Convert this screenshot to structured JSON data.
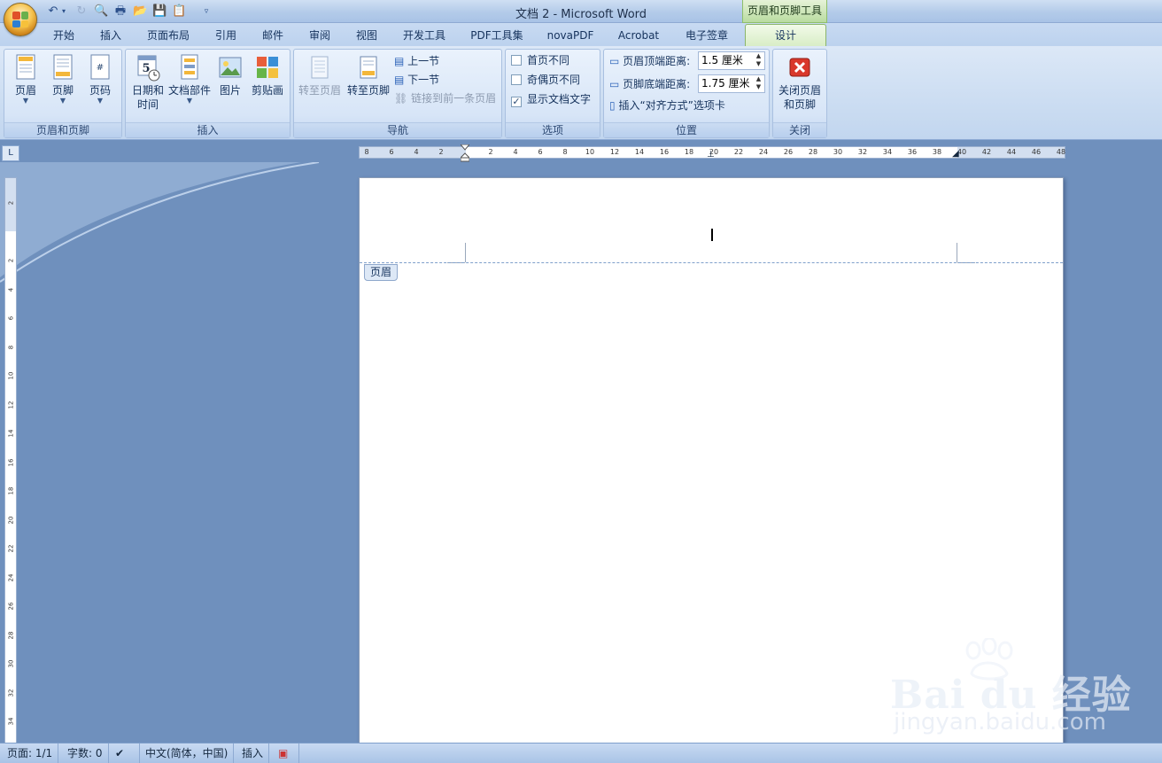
{
  "window": {
    "title": "文档 2 - Microsoft Word",
    "contextual_title": "页眉和页脚工具"
  },
  "qat": [
    "undo-icon",
    "redo-icon",
    "print-preview-icon",
    "print-icon",
    "open-icon",
    "save-icon",
    "paste-icon",
    "customize-icon"
  ],
  "tabs": [
    {
      "label": "开始"
    },
    {
      "label": "插入"
    },
    {
      "label": "页面布局"
    },
    {
      "label": "引用"
    },
    {
      "label": "邮件"
    },
    {
      "label": "审阅"
    },
    {
      "label": "视图"
    },
    {
      "label": "开发工具"
    },
    {
      "label": "PDF工具集"
    },
    {
      "label": "novaPDF"
    },
    {
      "label": "Acrobat"
    },
    {
      "label": "电子签章"
    }
  ],
  "active_tab": "设计",
  "ribbon": {
    "hf": {
      "label": "页眉和页脚",
      "header": "页眉",
      "footer": "页脚",
      "pagenum": "页码"
    },
    "insert": {
      "label": "插入",
      "datetime_1": "日期和",
      "datetime_2": "时间",
      "parts": "文档部件",
      "picture": "图片",
      "clipart": "剪贴画"
    },
    "nav": {
      "label": "导航",
      "goto_header": "转至页眉",
      "goto_footer": "转至页脚",
      "prev": "上一节",
      "next": "下一节",
      "link": "链接到前一条页眉"
    },
    "options": {
      "label": "选项",
      "first_diff": "首页不同",
      "odd_even": "奇偶页不同",
      "show_text": "显示文档文字",
      "first_checked": false,
      "odd_checked": false,
      "show_checked": true
    },
    "position": {
      "label": "位置",
      "header_top": "页眉顶端距离:",
      "header_top_value": "1.5 厘米",
      "footer_bottom": "页脚底端距离:",
      "footer_bottom_value": "1.75 厘米",
      "align_tab": "插入“对齐方式”选项卡"
    },
    "close": {
      "label": "关闭",
      "btn_1": "关闭页眉",
      "btn_2": "和页脚"
    }
  },
  "ruler_corner": "L",
  "hruler_ticks": [
    "8",
    "6",
    "4",
    "2",
    "",
    "2",
    "4",
    "6",
    "8",
    "10",
    "12",
    "14",
    "16",
    "18",
    "20",
    "22",
    "24",
    "26",
    "28",
    "30",
    "32",
    "34",
    "36",
    "38",
    "40",
    "42",
    "44",
    "46",
    "48"
  ],
  "vruler_ticks": [
    "2",
    "",
    "2",
    "4",
    "6",
    "8",
    "10",
    "12",
    "14",
    "16",
    "18",
    "20",
    "22",
    "24",
    "26",
    "28",
    "30",
    "32",
    "34",
    "36"
  ],
  "document": {
    "header_label": "页眉"
  },
  "status": {
    "page": "页面: 1/1",
    "words": "字数: 0",
    "lang": "中文(简体，中国)",
    "mode": "插入"
  },
  "watermark": {
    "brand": "Bai du 经验",
    "url": "jingyan.baidu.com"
  }
}
